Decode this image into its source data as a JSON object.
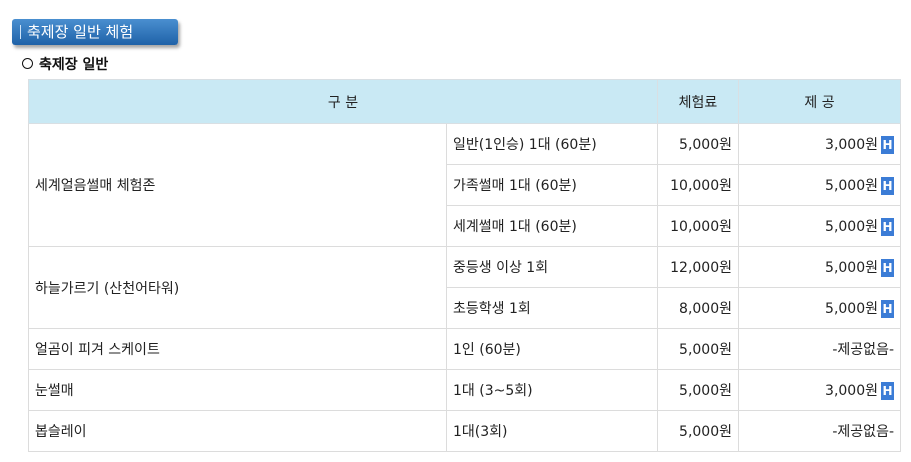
{
  "section_title": "축제장 일반 체험",
  "subhead": "축제장 일반",
  "table": {
    "headers": [
      "구 분",
      "체험료",
      "제 공"
    ],
    "rows": [
      {
        "name": "세계얼음썰매 체험존",
        "option": "일반(1인승) 1대 (60분)",
        "fee": "5,000원",
        "provide": "3,000원",
        "badge": "H"
      },
      {
        "option": "가족썰매 1대 (60분)",
        "fee": "10,000원",
        "provide": "5,000원",
        "badge": "H"
      },
      {
        "option": "세계썰매 1대 (60분)",
        "fee": "10,000원",
        "provide": "5,000원",
        "badge": "H"
      },
      {
        "name": "하늘가르기 (산천어타워)",
        "option": "중등생 이상 1회",
        "fee": "12,000원",
        "provide": "5,000원",
        "badge": "H"
      },
      {
        "option": "초등학생 1회",
        "fee": "8,000원",
        "provide": "5,000원",
        "badge": "H"
      },
      {
        "name": "얼곰이 피겨 스케이트",
        "option": "1인 (60분)",
        "fee": "5,000원",
        "provide": "-제공없음-"
      },
      {
        "name": "눈썰매",
        "option": "1대 (3~5회)",
        "fee": "5,000원",
        "provide": "3,000원",
        "badge": "H"
      },
      {
        "name": "봅슬레이",
        "option": "1대(3회)",
        "fee": "5,000원",
        "provide": "-제공없음-"
      }
    ]
  }
}
